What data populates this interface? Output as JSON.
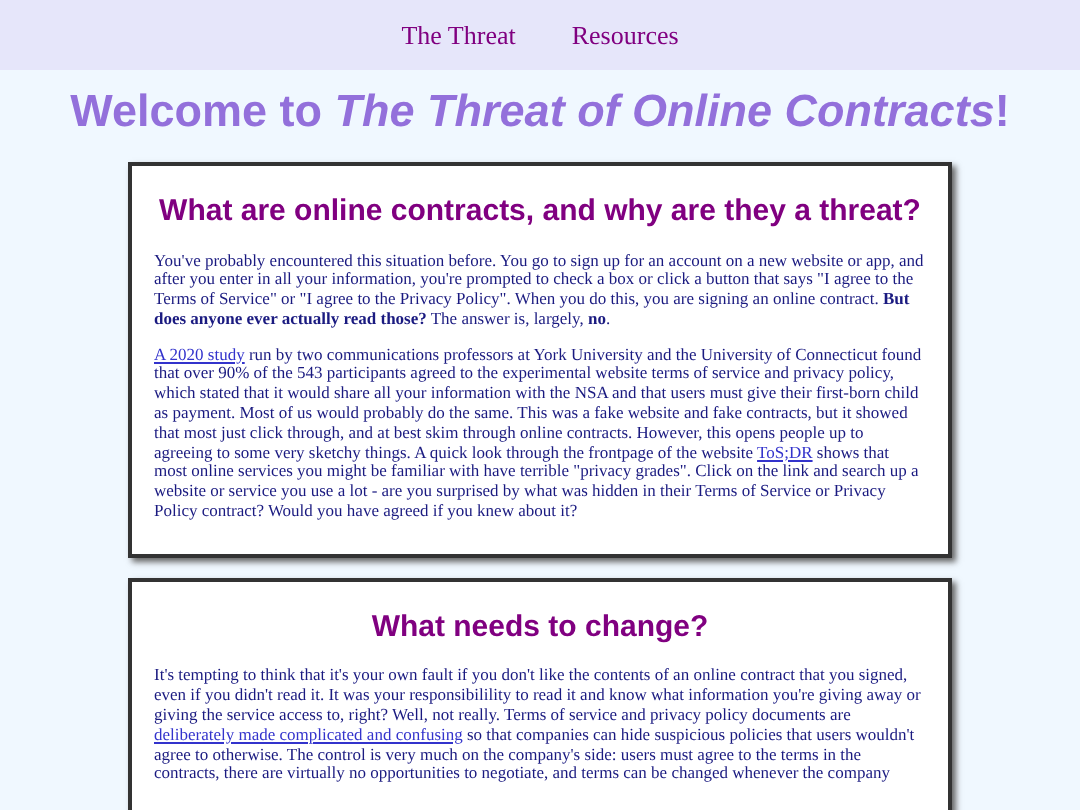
{
  "nav": {
    "links": [
      "The Threat",
      "Resources"
    ]
  },
  "page_title": {
    "prefix": "Welcome to ",
    "emphasis": "The Threat of Online Contracts",
    "suffix": "!"
  },
  "sections": [
    {
      "heading": "What are online contracts, and why are they a threat?",
      "paragraphs": [
        [
          {
            "kind": "text",
            "text": "You've probably encountered this situation before. You go to sign up for an account on a new website or app, and after you enter in all your information, you're prompted to check a box or click a button that says \"I agree to the Terms of Service\" or \"I agree to the Privacy Policy\". When you do this, you are signing an online contract. **But does anyone ever actually read those?** The answer is, largely, **no**."
          }
        ],
        [
          {
            "kind": "link",
            "text": "A 2020 study"
          },
          {
            "kind": "text",
            "text": " run by two communications professors at York University and the University of Connecticut found that over 90% of the 543 participants agreed to the experimental website terms of service and privacy policy, which stated that it would share all your information with the NSA and that users must give their first-born child as payment. Most of us would probably do the same. This was a fake website and fake contracts, but it showed that most just click through, and at best skim through online contracts. However, this opens people up to agreeing to some very sketchy things. A quick look through the frontpage of the website "
          },
          {
            "kind": "link",
            "text": "ToS;DR"
          },
          {
            "kind": "text",
            "text": " shows that most online services you might be familiar with have terrible \"privacy grades\". Click on the link and search up a website or service you use a lot - are you surprised by what was hidden in their Terms of Service or Privacy Policy contract? Would you have agreed if you knew about it?"
          }
        ]
      ]
    },
    {
      "heading": "What needs to change?",
      "paragraphs": [
        [
          {
            "kind": "text",
            "text": "It's tempting to think that it's your own fault if you don't like the contents of an online contract that you signed, even if you didn't read it. It was your responsibilility to read it and know what information you're giving away or giving the service access to, right? Well, not really. Terms of service and privacy policy documents are "
          },
          {
            "kind": "link",
            "text": "deliberately made complicated and confusing"
          },
          {
            "kind": "text",
            "text": " so that companies can hide suspicious policies that users wouldn't agree to otherwise. The control is very much on the company's side: users must agree to the terms in the contracts, there are virtually no opportunities to negotiate, and terms can be changed whenever the company"
          }
        ]
      ]
    }
  ]
}
